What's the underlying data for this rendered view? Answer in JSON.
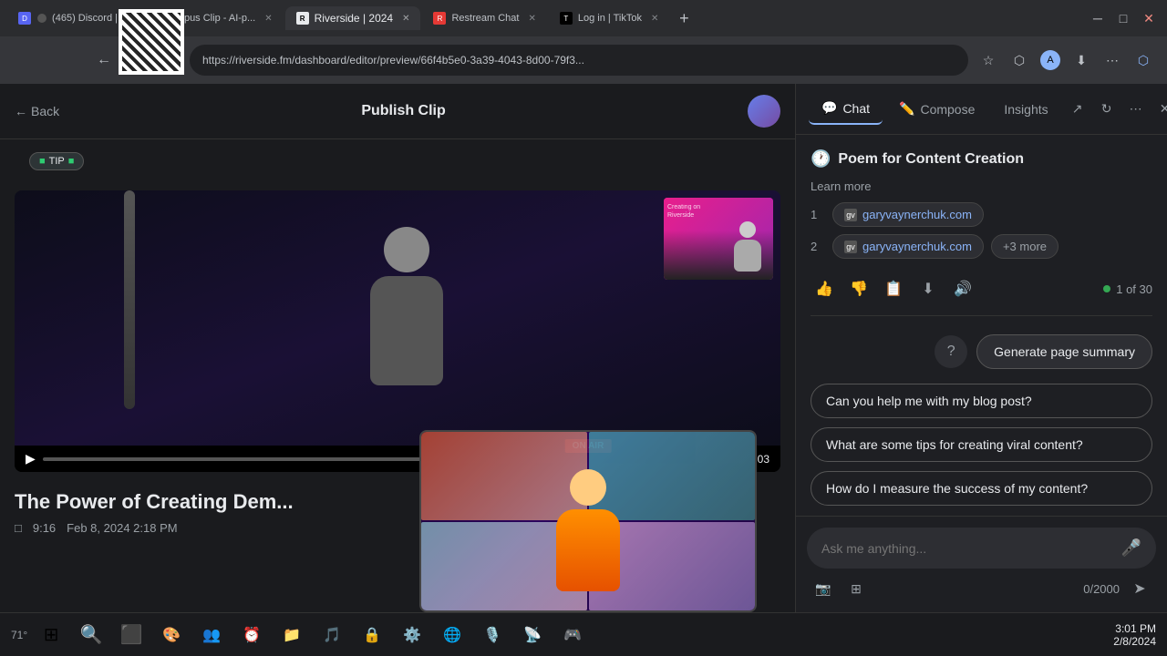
{
  "browser": {
    "tabs": [
      {
        "id": "discord",
        "label": "(465) Discord |",
        "favicon": "D",
        "active": false,
        "count": "465"
      },
      {
        "id": "opus",
        "label": "Opus Clip - AI-p...",
        "favicon": "O",
        "active": false
      },
      {
        "id": "riverside",
        "label": "Riverside | 2024",
        "favicon": "R",
        "active": true
      },
      {
        "id": "restream",
        "label": "Restream Chat",
        "favicon": "R",
        "active": false
      },
      {
        "id": "tiktok",
        "label": "Log in | TikTok",
        "favicon": "T",
        "active": false
      }
    ],
    "url": "https://riverside.fm/dashboard/editor/preview/66f4b5e0-3a39-4043-8d00-79f3...",
    "new_tab_label": "+"
  },
  "editor": {
    "back_label": "Back",
    "title": "Publish Clip",
    "tip_label": "TIP",
    "video_time": "00:00 / 01:03",
    "content_title": "The Power of Creating Dem...",
    "content_duration": "9:16",
    "content_date": "Feb 8, 2024 2:18 PM"
  },
  "chat_panel": {
    "tabs": [
      {
        "id": "chat",
        "label": "Chat",
        "active": true
      },
      {
        "id": "compose",
        "label": "Compose",
        "active": false
      },
      {
        "id": "insights",
        "label": "Insights",
        "active": false
      }
    ],
    "summary_title": "Poem for Content Creation",
    "learn_more_label": "Learn more",
    "sources": [
      {
        "num": "1",
        "favicon": "gv",
        "url": "garyvaynerchuk.com"
      },
      {
        "num": "2",
        "favicon": "gv",
        "url": "garyvaynerchuk.com"
      }
    ],
    "more_sources_label": "+3 more",
    "count_label": "1 of 30",
    "generate_btn_label": "Generate page summary",
    "suggestions": [
      {
        "label": "Can you help me with my blog post?"
      },
      {
        "label": "What are some tips for creating viral content?"
      },
      {
        "label": "How do I measure the success of my content?"
      }
    ],
    "input_placeholder": "Ask me anything...",
    "char_count": "0/2000"
  },
  "taskbar": {
    "time": "3:01 PM",
    "date": "2/8/2024",
    "temperature": "71°"
  },
  "colors": {
    "accent_blue": "#8ab4f8",
    "green": "#34a853",
    "bg_dark": "#1a1b1e",
    "panel_bg": "#1e1f23"
  }
}
